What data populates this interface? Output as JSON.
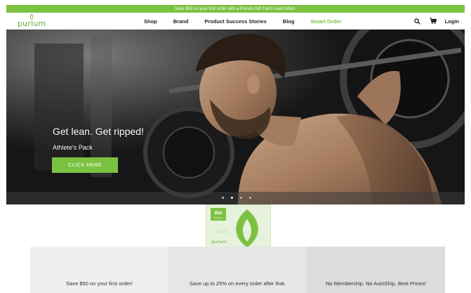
{
  "promo": {
    "text": "Save $50 on your first order with a Purium Gift Card! Learn More."
  },
  "navbar": {
    "logo": "purium",
    "links": [
      {
        "label": "Shop"
      },
      {
        "label": "Brand"
      },
      {
        "label": "Product Success Stories"
      },
      {
        "label": "Blog"
      },
      {
        "label": "Smart Order"
      }
    ],
    "login_label": "Login",
    "icons": [
      "search-icon",
      "cart-icon"
    ]
  },
  "hero": {
    "title": "Get lean. Get ripped!",
    "subtitle": "Athlete's Pack",
    "cta_label": "CLICK HERE",
    "slide_count": 4,
    "active_slide": 1
  },
  "gift_card": {
    "amount": "$50",
    "caption": "Gift Card",
    "brand": "purium",
    "word": "LOVE"
  },
  "benefits": [
    {
      "text": "Save $50 on your first order!"
    },
    {
      "text": "Save up to 25% on every order after that."
    },
    {
      "text": "No Membership. No AutoShip. Best Prices!"
    }
  ],
  "colors": {
    "brand_green": "#7cc242",
    "text_dark": "#222222"
  }
}
